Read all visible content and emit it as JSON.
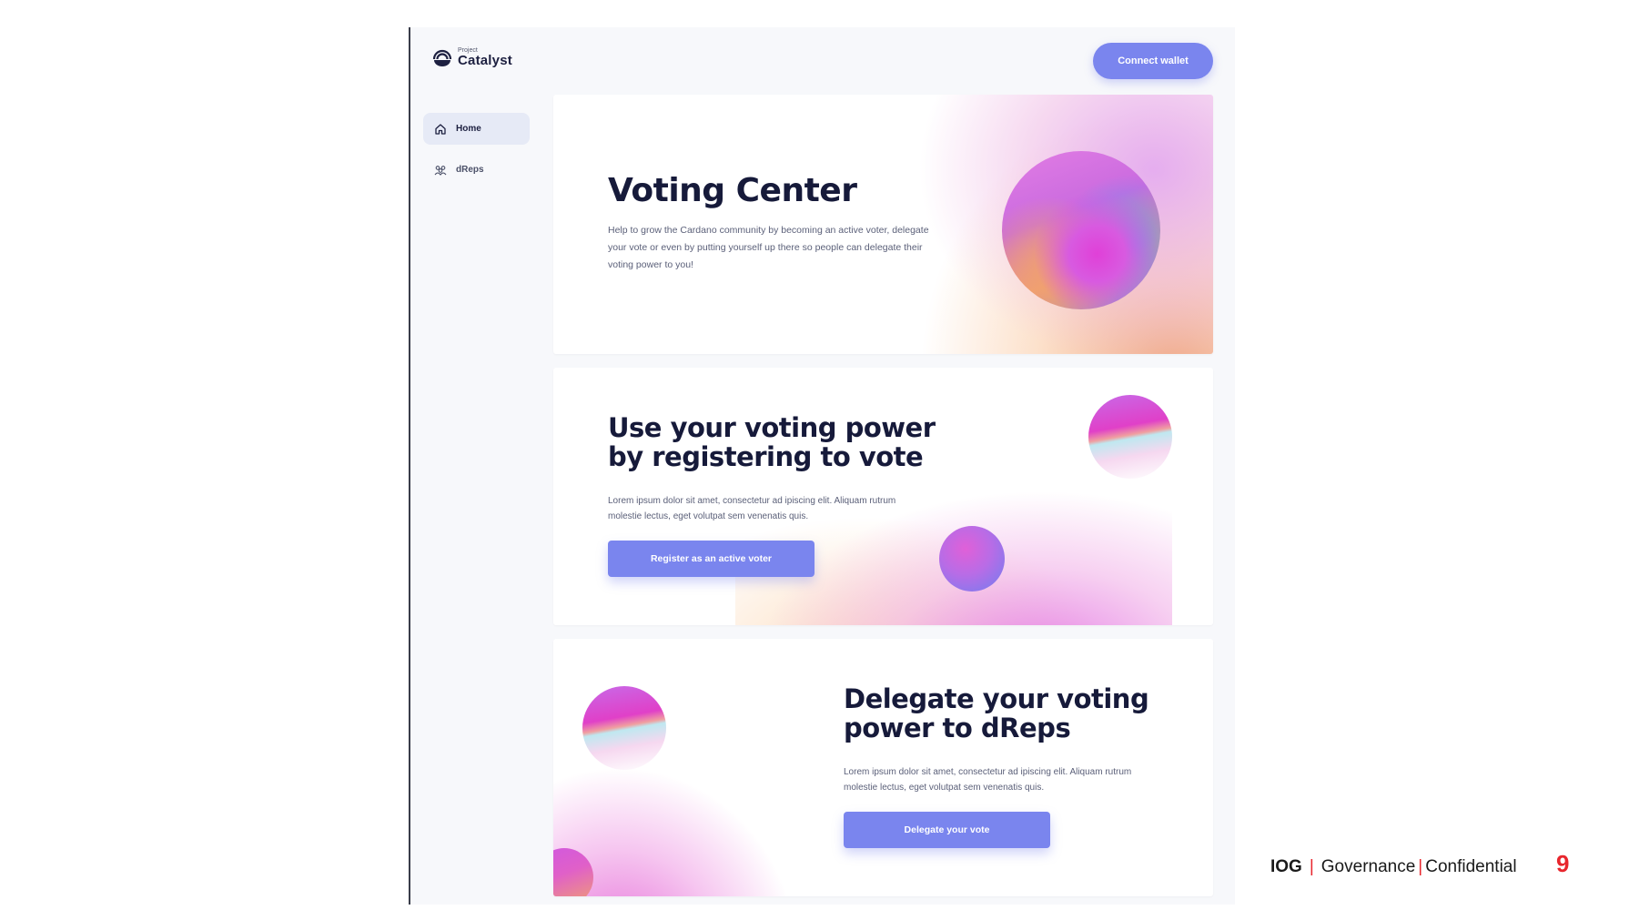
{
  "app": {
    "logo_small": "Project",
    "logo_name": "Catalyst"
  },
  "sidebar": {
    "items": [
      {
        "label": "Home",
        "icon": "home-icon",
        "active": true
      },
      {
        "label": "dReps",
        "icon": "people-icon",
        "active": false
      }
    ]
  },
  "header": {
    "connect_label": "Connect wallet"
  },
  "hero": {
    "title": "Voting Center",
    "body": "Help to grow the Cardano community by becoming an active voter, delegate your vote or even by putting yourself up there so people can delegate their voting power to you!"
  },
  "register": {
    "title_line1": "Use your voting power",
    "title_line2": "by registering to vote",
    "body": "Lorem ipsum dolor sit amet, consectetur ad ipiscing elit. Aliquam rutrum molestie lectus, eget volutpat sem venenatis quis.",
    "cta_label": "Register as an active voter"
  },
  "delegate": {
    "title_line1": "Delegate your voting",
    "title_line2": "power to dReps",
    "body": "Lorem ipsum dolor sit amet, consectetur ad ipiscing elit. Aliquam rutrum molestie lectus, eget volutpat sem venenatis quis.",
    "cta_label": "Delegate your vote"
  },
  "footer": {
    "brand": "IOG",
    "divider": "|",
    "section": "Governance",
    "divider2": "|",
    "classification": "Confidential",
    "page_number": "9"
  },
  "colors": {
    "accent": "#7a85ee",
    "heading": "#161a3a",
    "footer_red": "#e8262d"
  }
}
